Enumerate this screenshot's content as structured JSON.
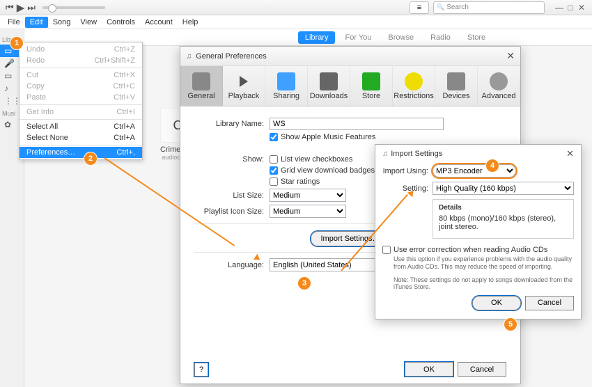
{
  "topbar": {
    "search_placeholder": "Search"
  },
  "menubar": {
    "file": "File",
    "edit": "Edit",
    "song": "Song",
    "view": "View",
    "controls": "Controls",
    "account": "Account",
    "help": "Help"
  },
  "sidebar": {
    "library_hdr": "Libra",
    "music_hdr": "Musi"
  },
  "nav": {
    "library": "Library",
    "foryou": "For You",
    "browse": "Browse",
    "radio": "Radio",
    "store": "Store"
  },
  "tile": {
    "line1": "C",
    "title": "Crime Jun",
    "artist": "audiochuck"
  },
  "edit_menu": {
    "undo": "Undo",
    "undo_k": "Ctrl+Z",
    "redo": "Redo",
    "redo_k": "Ctrl+Shift+Z",
    "cut": "Cut",
    "cut_k": "Ctrl+X",
    "copy": "Copy",
    "copy_k": "Ctrl+C",
    "paste": "Paste",
    "paste_k": "Ctrl+V",
    "getinfo": "Get Info",
    "getinfo_k": "Ctrl+I",
    "selectall": "Select All",
    "selectall_k": "Ctrl+A",
    "selectnone": "Select None",
    "selectnone_k": "Ctrl+A",
    "prefs": "Preferences…",
    "prefs_k": "Ctrl+,"
  },
  "prefs": {
    "title": "General Preferences",
    "tabs": {
      "general": "General",
      "playback": "Playback",
      "sharing": "Sharing",
      "downloads": "Downloads",
      "store": "Store",
      "restrictions": "Restrictions",
      "devices": "Devices",
      "advanced": "Advanced"
    },
    "library_name_lbl": "Library Name:",
    "library_name_val": "WS",
    "show_amf": "Show Apple Music Features",
    "show_lbl": "Show:",
    "lv_checkboxes": "List view checkboxes",
    "gv_badges": "Grid view download badges",
    "star_ratings": "Star ratings",
    "list_size_lbl": "List Size:",
    "list_size_val": "Medium",
    "picon_lbl": "Playlist Icon Size:",
    "picon_val": "Medium",
    "import_settings_btn": "Import Settings…",
    "language_lbl": "Language:",
    "language_val": "English (United States)",
    "help": "?",
    "ok": "OK",
    "cancel": "Cancel"
  },
  "imp": {
    "title": "Import Settings",
    "using_lbl": "Import Using:",
    "using_val": "MP3 Encoder",
    "setting_lbl": "Setting:",
    "setting_val": "High Quality (160 kbps)",
    "details_hdr": "Details",
    "details_txt": "80 kbps (mono)/160 kbps (stereo), joint stereo.",
    "ec_label": "Use error correction when reading Audio CDs",
    "ec_hint": "Use this option if you experience problems with the audio quality from Audio CDs.  This may reduce the speed of importing.",
    "note": "Note: These settings do not apply to songs downloaded from the iTunes Store.",
    "ok": "OK",
    "cancel": "Cancel"
  },
  "badges": {
    "b1": "1",
    "b2": "2",
    "b3": "3",
    "b4": "4",
    "b5": "5"
  }
}
